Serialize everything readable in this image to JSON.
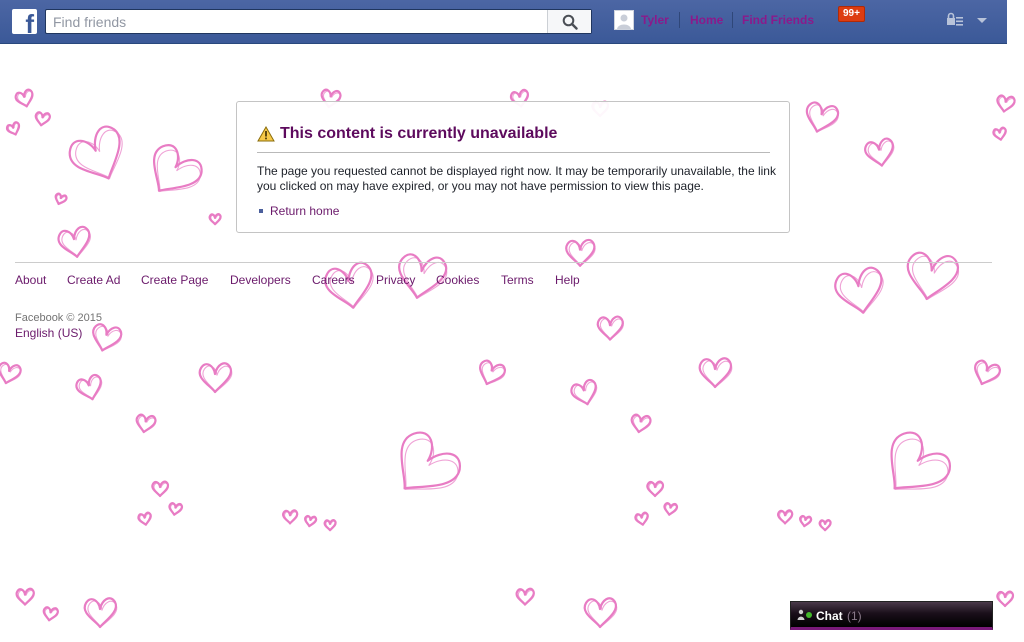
{
  "topbar": {
    "logo_icon": "facebook-logo-icon",
    "search": {
      "placeholder": "Find friends",
      "value": ""
    },
    "search_icon": "search-icon",
    "user_name": "Tyler",
    "home_label": "Home",
    "find_friends_label": "Find Friends",
    "notification_badge": "99+",
    "settings_icon": "privacy-shortcuts-icon",
    "dropdown_icon": "chevron-down-icon",
    "bar_color": "#3b5998"
  },
  "error_card": {
    "title": "This content is currently unavailable",
    "message": "The page you requested cannot be displayed right now. It may be temporarily unavailable, the link you clicked on may have expired, or you may not have permission to view this page.",
    "return_link": "Return home",
    "warning_icon": "warning-icon",
    "title_color": "#5d0a5d"
  },
  "footer": {
    "links": [
      "About",
      "Create Ad",
      "Create Page",
      "Developers",
      "Careers",
      "Privacy",
      "Cookies",
      "Terms",
      "Help"
    ],
    "copyright": "Facebook © 2015",
    "language": "English (US)",
    "link_color": "#6b1a6b"
  },
  "chat": {
    "label": "Chat",
    "count": "(1)",
    "icon": "chat-online-icon"
  },
  "background": {
    "pattern": "pink-hand-drawn-hearts",
    "heart_color": "#e87cc4"
  }
}
